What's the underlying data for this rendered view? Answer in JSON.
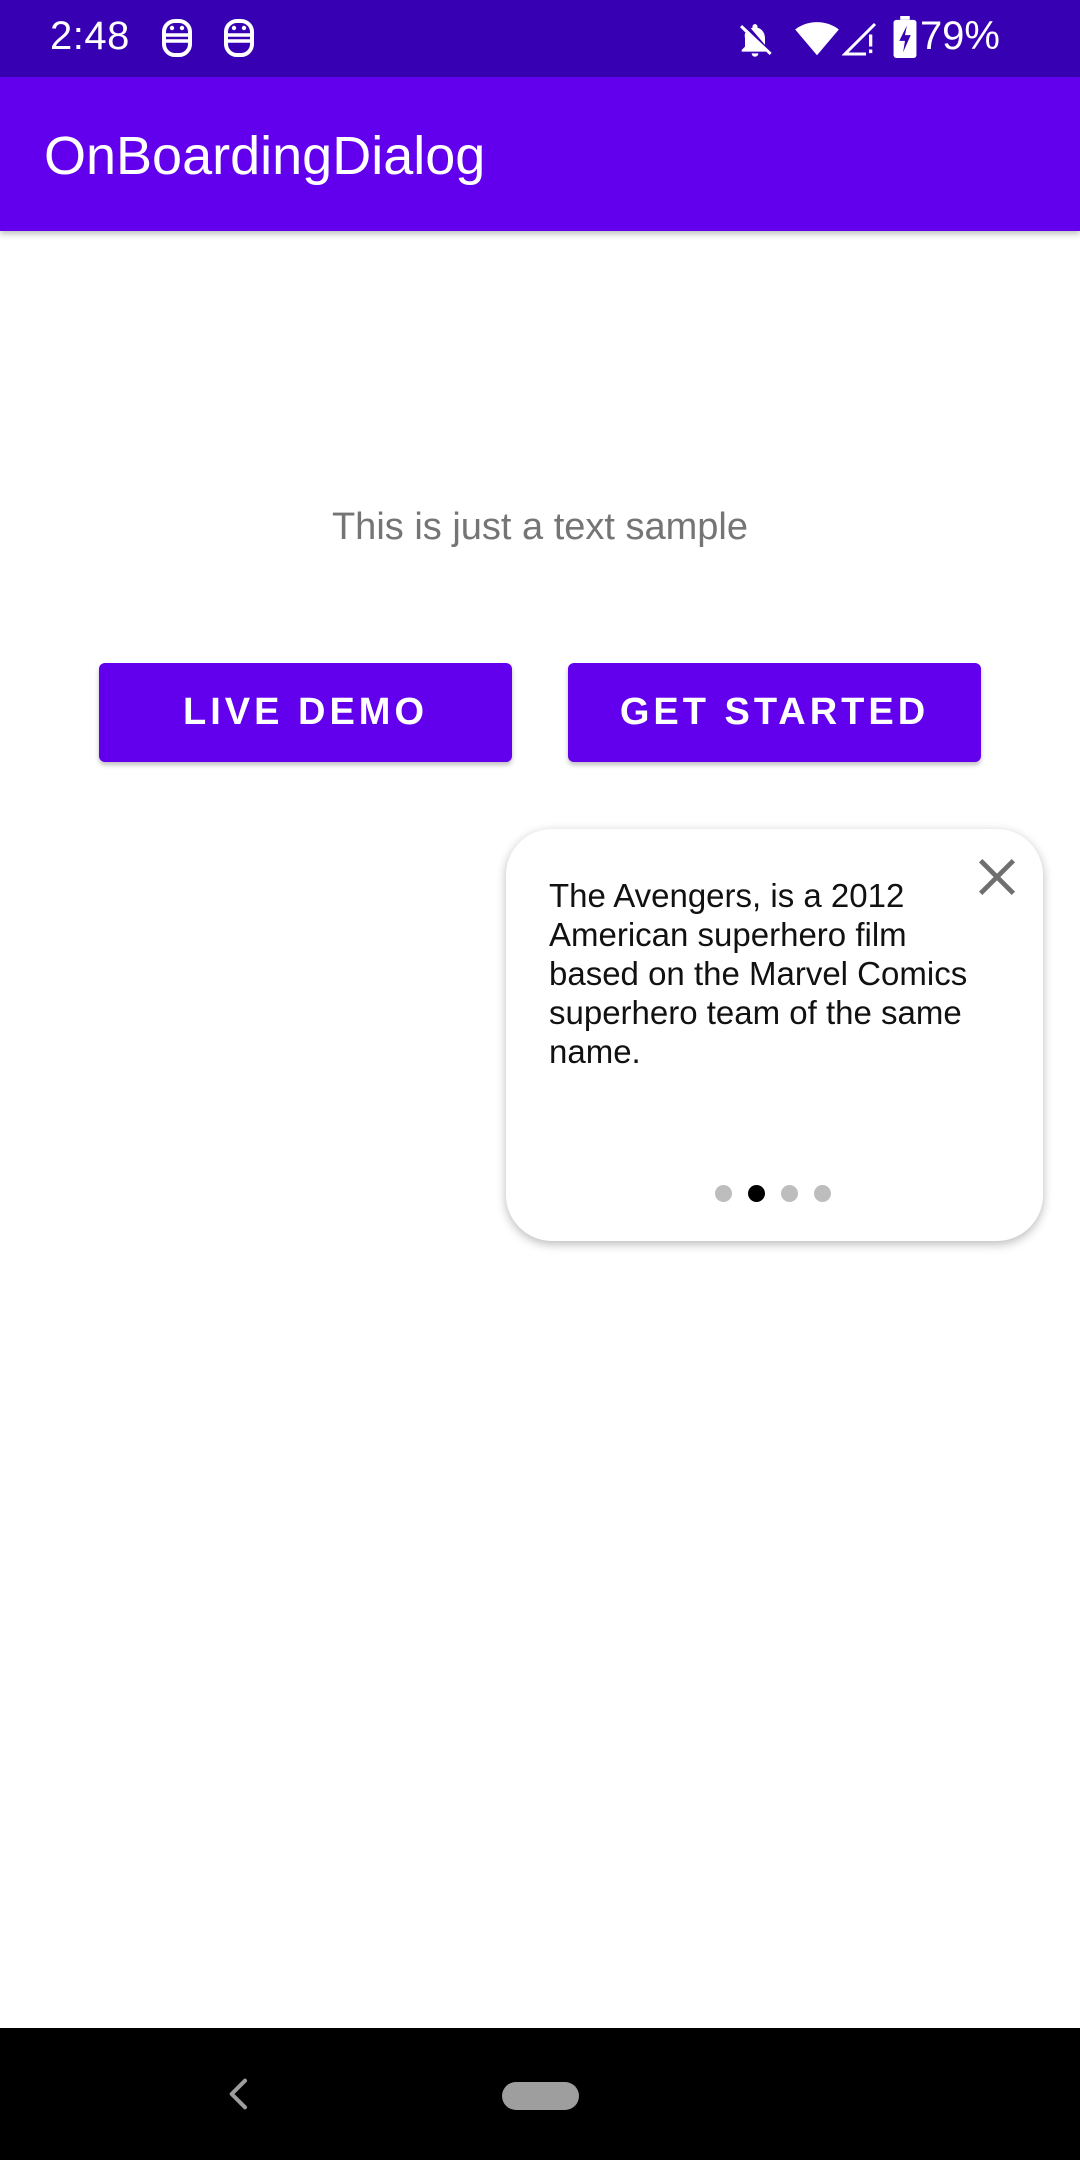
{
  "status_bar": {
    "time": "2:48",
    "battery": "79%",
    "left_icons": [
      "notification-app-icon",
      "notification-app-icon"
    ],
    "right_icons": [
      "notifications-off-icon",
      "wifi-icon",
      "signal-icon",
      "battery-charging-icon"
    ],
    "color": "#3700b3"
  },
  "app_bar": {
    "title": "OnBoardingDialog",
    "color": "#6200ee"
  },
  "main": {
    "sample_text": "This is just a text sample",
    "buttons": {
      "live_demo": "LIVE DEMO",
      "get_started": "GET STARTED"
    }
  },
  "onboarding_dialog": {
    "text": "The Avengers, is a 2012 American superhero film based on the Marvel Comics superhero team of the same name.",
    "close_icon": "close-icon",
    "page_count": 4,
    "current_page_index": 1
  },
  "nav_bar": {
    "back_icon": "back-icon",
    "home_icon": "home-pill-icon"
  }
}
